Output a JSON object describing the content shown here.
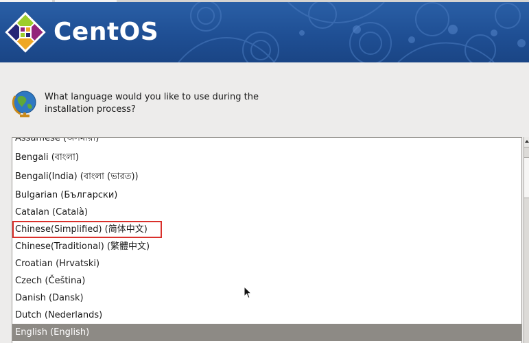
{
  "app": {
    "brand": "CentOS",
    "question": "What language would you like to use during the installation process?"
  },
  "languages": {
    "items": [
      "Assamese (অসমীয়া)",
      "Bengali (বাংলা)",
      "Bengali(India) (বাংলা (ভারত))",
      "Bulgarian (Български)",
      "Catalan (Català)",
      "Chinese(Simplified) (简体中文)",
      "Chinese(Traditional) (繁體中文)",
      "Croatian (Hrvatski)",
      "Czech (Čeština)",
      "Danish (Dansk)",
      "Dutch (Nederlands)",
      "English (English)"
    ],
    "selected": "English (English)",
    "highlighted": "Chinese(Simplified) (简体中文)"
  },
  "colors": {
    "banner": "#1f4f94",
    "selection": "#8d8a85",
    "highlight_box": "#d9302b"
  },
  "icons": [
    "centos-logo-icon",
    "globe-icon",
    "mouse-pointer-icon",
    "scroll-up-arrow-icon"
  ]
}
